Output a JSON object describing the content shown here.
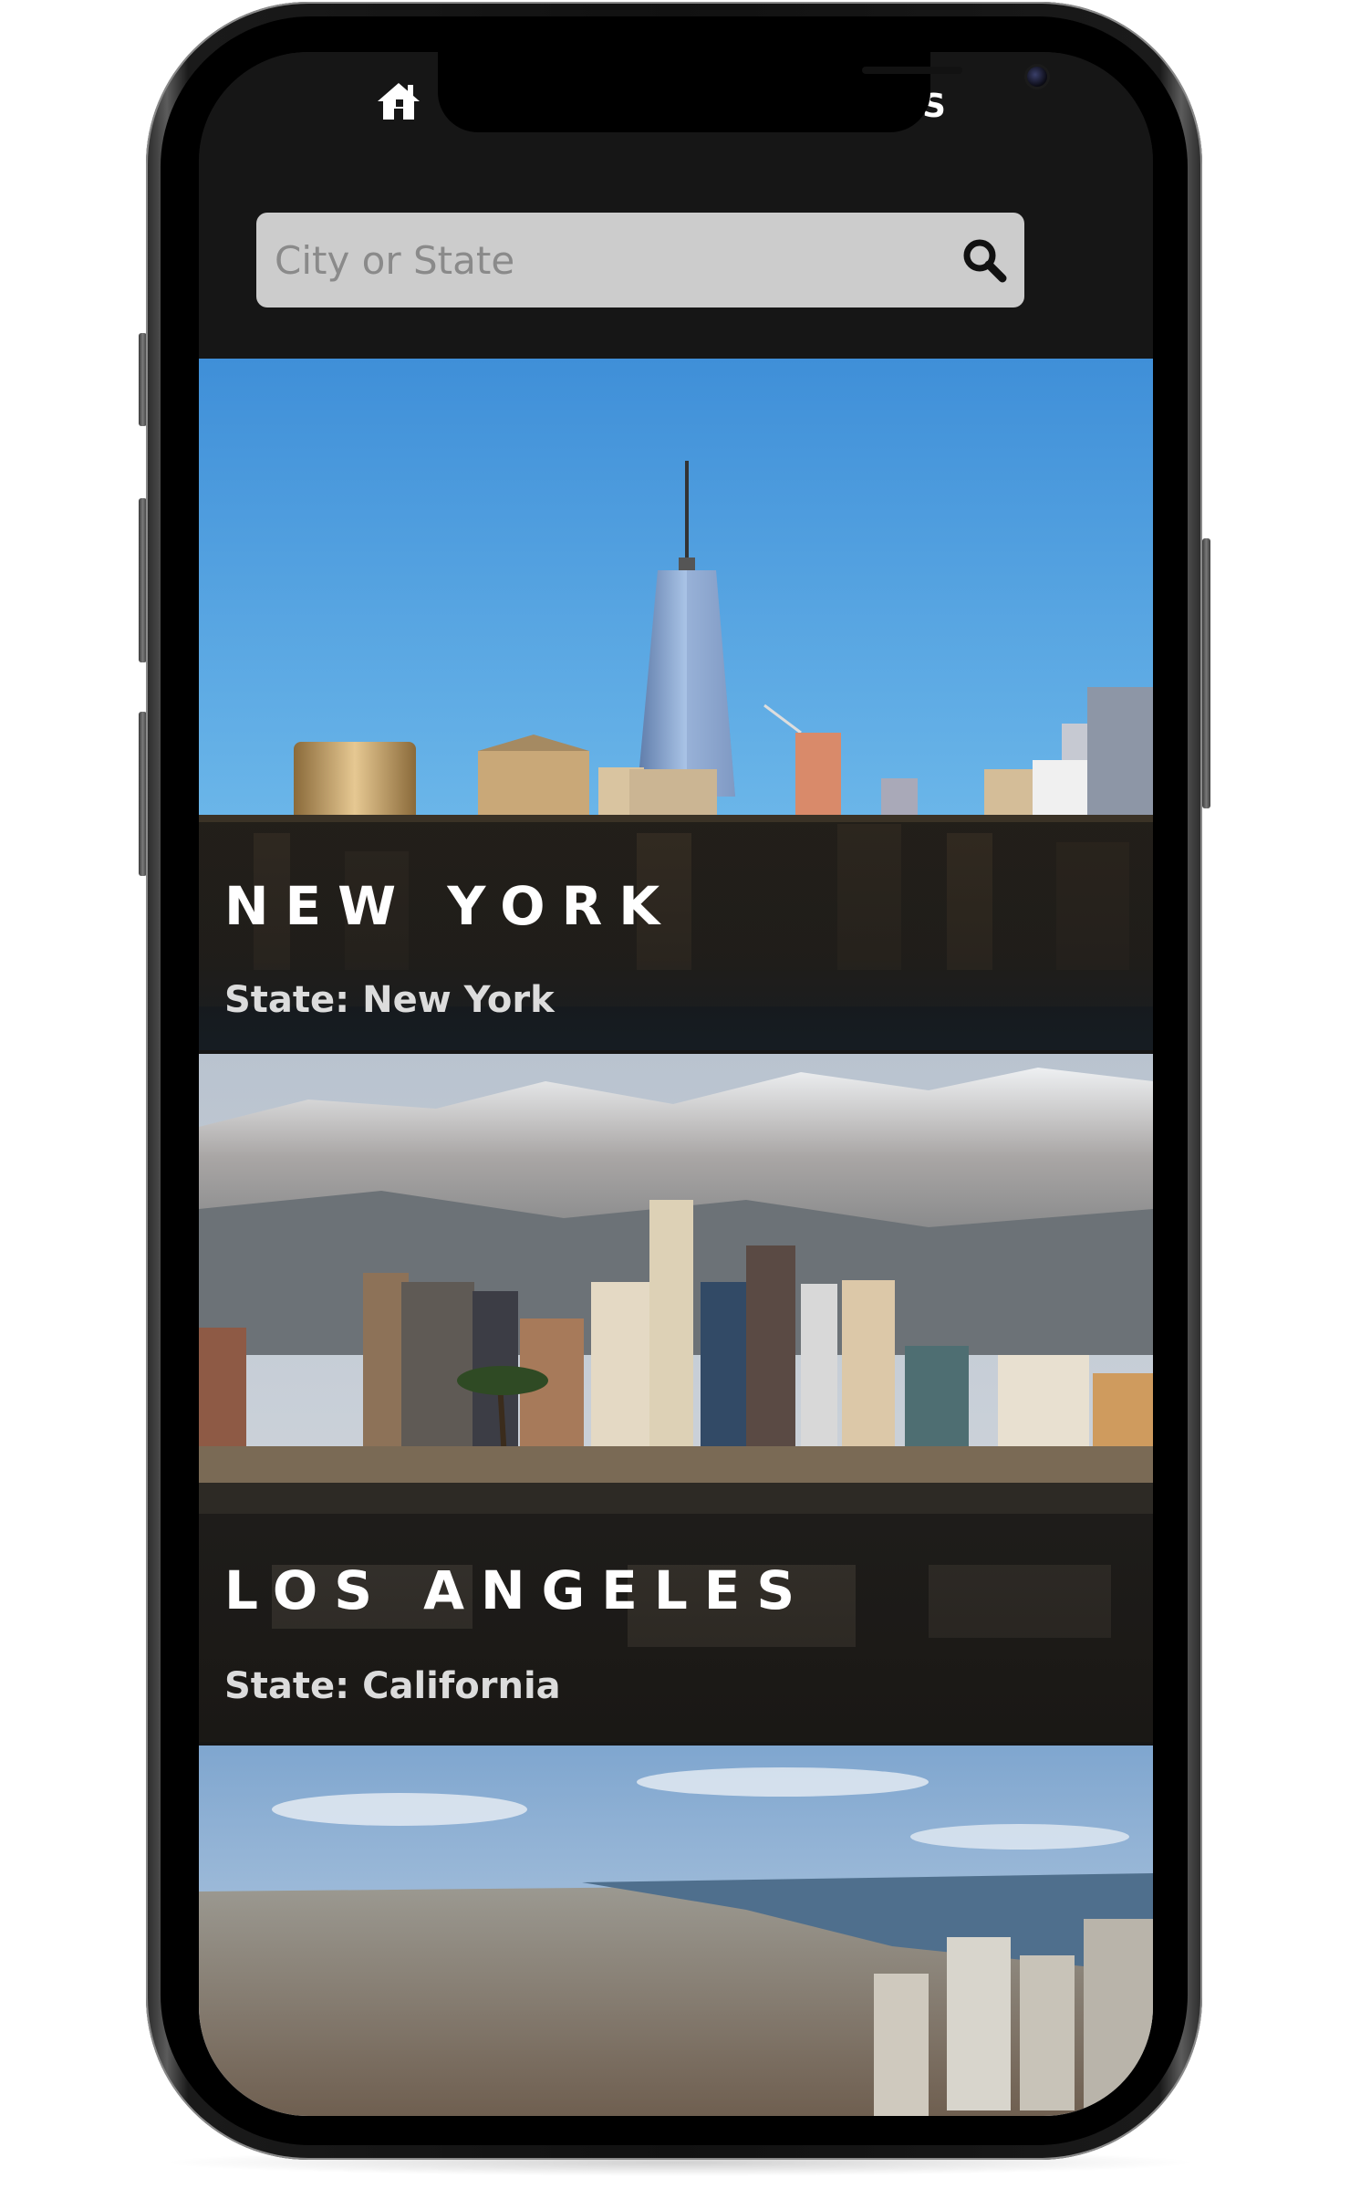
{
  "header": {
    "nav_partial_label": "S",
    "search": {
      "placeholder": "City or State",
      "value": ""
    }
  },
  "cities": [
    {
      "name": "NEW YORK",
      "state_line": "State: New York"
    },
    {
      "name": "LOS ANGELES",
      "state_line": "State: California"
    },
    {
      "name": "",
      "state_line": ""
    }
  ],
  "icons": {
    "home": "home-icon",
    "search": "search-icon"
  },
  "colors": {
    "app_background": "#161616",
    "search_background": "#cccccc",
    "title_text": "#ffffff"
  }
}
